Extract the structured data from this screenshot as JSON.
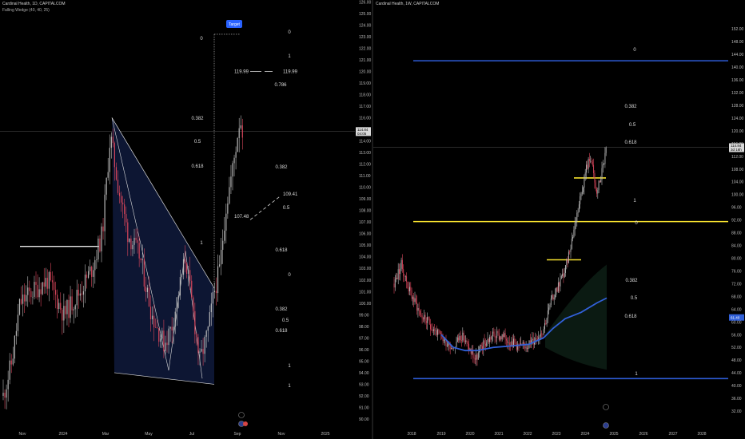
{
  "left": {
    "title": "Cardinal Health, 1D, CAPITALCOM",
    "indicator": "Falling Wedge (40, 40, 25)",
    "target_label": "Target",
    "yaxis_ticks": [
      "90.00",
      "91.00",
      "92.00",
      "93.00",
      "94.00",
      "95.00",
      "96.00",
      "97.00",
      "98.00",
      "99.00",
      "100.00",
      "101.00",
      "102.00",
      "103.00",
      "104.00",
      "105.00",
      "106.00",
      "107.00",
      "108.00",
      "109.00",
      "110.00",
      "111.00",
      "112.00",
      "113.00",
      "114.00",
      "115.00",
      "116.00",
      "117.00",
      "118.00",
      "119.00",
      "120.00",
      "121.00",
      "122.00",
      "123.00",
      "124.00",
      "125.00",
      "126.00"
    ],
    "xaxis_ticks": [
      "Nov",
      "2024",
      "Mar",
      "May",
      "Jul",
      "Sep",
      "Nov",
      "2025"
    ],
    "price_tag": [
      "114.84",
      "04:05"
    ],
    "fib_labels": [
      {
        "t": "0",
        "group": "a"
      },
      {
        "t": "0.382",
        "group": "a"
      },
      {
        "t": "0.5",
        "group": "a"
      },
      {
        "t": "0.618",
        "group": "a"
      },
      {
        "t": "1",
        "group": "a"
      },
      {
        "t": "0",
        "group": "b"
      },
      {
        "t": "1",
        "group": "b"
      },
      {
        "t": "0.786",
        "group": "b"
      },
      {
        "t": "0.382",
        "group": "b"
      },
      {
        "t": "0.5",
        "group": "b"
      },
      {
        "t": "0.618",
        "group": "b"
      },
      {
        "t": "0",
        "group": "c"
      },
      {
        "t": "0.382",
        "group": "c"
      },
      {
        "t": "0.5",
        "group": "c"
      },
      {
        "t": "0.618",
        "group": "c"
      },
      {
        "t": "1",
        "group": "c"
      },
      {
        "t": "1",
        "group": "d"
      }
    ],
    "projection_labels": [
      "119.99",
      "119.99",
      "107.48",
      "109.41"
    ]
  },
  "right": {
    "title": "Cardinal Health, 1W, CAPITALCOM",
    "yaxis_ticks": [
      "32.00",
      "36.00",
      "40.00",
      "44.00",
      "48.00",
      "52.00",
      "56.00",
      "60.00",
      "64.00",
      "68.00",
      "72.00",
      "76.00",
      "80.00",
      "84.00",
      "88.00",
      "92.00",
      "96.00",
      "100.00",
      "104.00",
      "108.00",
      "112.00",
      "116.00",
      "120.00",
      "124.00",
      "128.00",
      "132.00",
      "136.00",
      "140.00",
      "144.00",
      "148.00",
      "152.00"
    ],
    "xaxis_ticks": [
      "2018",
      "2019",
      "2020",
      "2021",
      "2022",
      "2023",
      "2024",
      "2025",
      "2026",
      "2027",
      "2028"
    ],
    "price_tag": [
      "114.84",
      "3d 16h"
    ],
    "ma_tag": "61.40",
    "fib_labels": [
      "0",
      "0.382",
      "0.5",
      "0.618",
      "1",
      "0",
      "0.382",
      "0.5",
      "0.618",
      "1"
    ]
  },
  "colors": {
    "background": "#000000",
    "candle_up": "#b9b9b9",
    "candle_down": "#d6455a",
    "wedge_fill": "#0d1633",
    "ma_line": "#3160d8",
    "level_yellow": "#f5e02e",
    "level_blue": "#2e5bd6",
    "target_box": "#2962ff"
  },
  "chart_data": [
    {
      "type": "candlestick",
      "title": "Cardinal Health, 1D, CAPITALCOM",
      "x": [
        "Nov 2023",
        "2024",
        "Mar 2024",
        "May 2024",
        "Jul 2024",
        "Sep 2024"
      ],
      "close_path": [
        92.0,
        99.0,
        103.0,
        101.0,
        116.0,
        103.0,
        97.0,
        104.5,
        94.0,
        102.0,
        114.8
      ],
      "ylim": [
        90,
        126
      ],
      "last_price": 114.84,
      "annotations": {
        "wedge_top": 116.0,
        "wedge_bottom_left": 94.0,
        "wedge_bottom_right": 93.0,
        "horizontal_support": 104.9,
        "target": 119.99,
        "projection_path": [
          107.48,
          109.41
        ]
      }
    },
    {
      "type": "candlestick",
      "title": "Cardinal Health, 1W, CAPITALCOM",
      "x": [
        "2018",
        "2019",
        "2020",
        "2021",
        "2022",
        "2023",
        "2024",
        "2025"
      ],
      "close_path": [
        72.0,
        60.0,
        50.0,
        50.0,
        54.0,
        70.0,
        100.0,
        114.8
      ],
      "ylim": [
        30,
        153
      ],
      "last_price": 114.84,
      "moving_average_last": 61.4,
      "levels": {
        "blue_top": 142.0,
        "yellow_upper": 105.0,
        "yellow_mid": 91.5,
        "yellow_lower": 79.5,
        "blue_bottom": 42.0
      }
    }
  ]
}
